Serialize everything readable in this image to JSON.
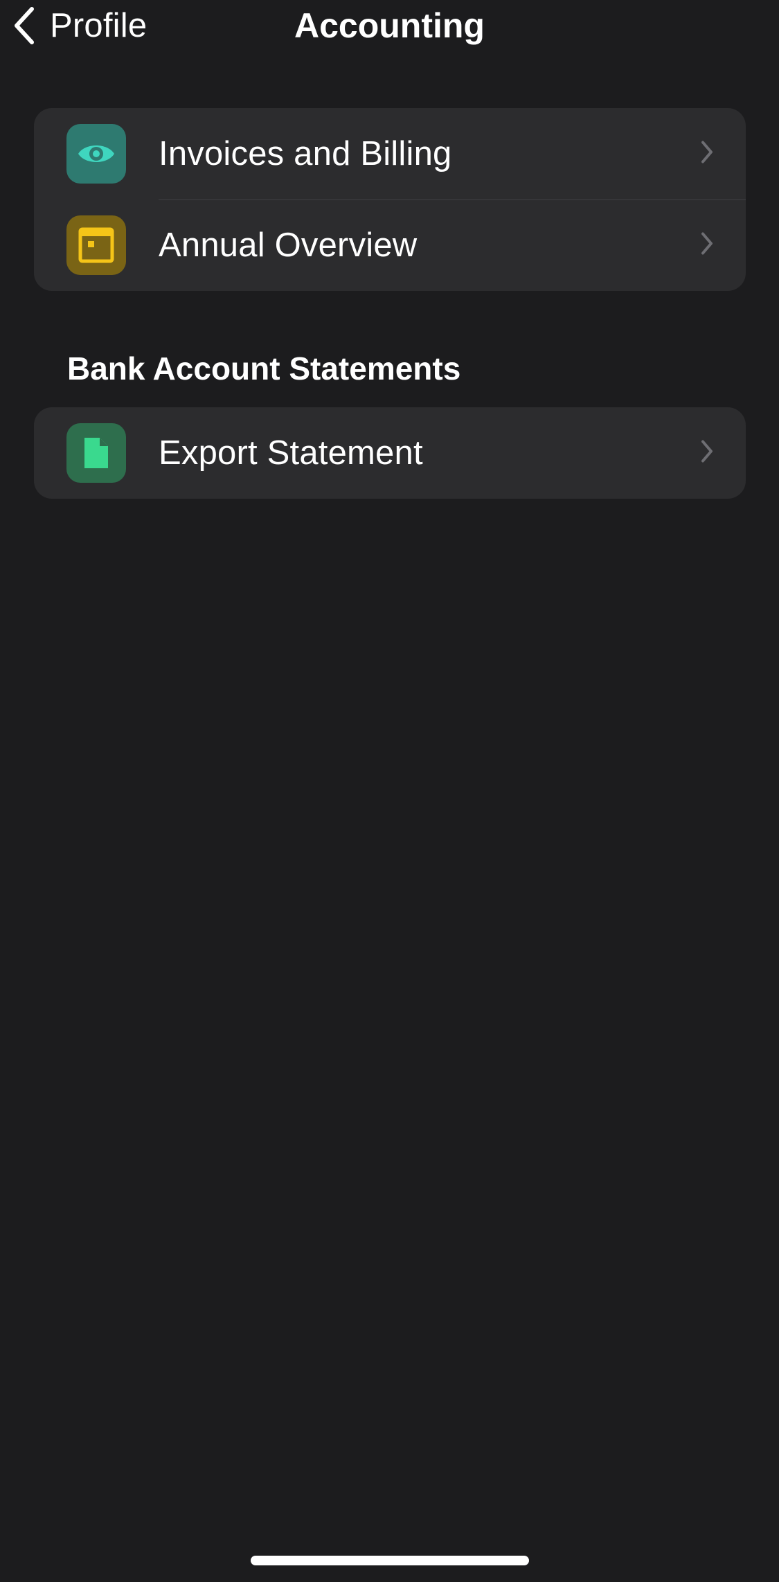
{
  "nav": {
    "back_label": "Profile",
    "title": "Accounting"
  },
  "group1": {
    "items": [
      {
        "label": "Invoices and Billing",
        "icon": "eye-icon",
        "tile_color": "#2e7a70",
        "glyph_color": "#3fd6bf"
      },
      {
        "label": "Annual Overview",
        "icon": "calendar-icon",
        "tile_color": "#7a6415",
        "glyph_color": "#f5c518"
      }
    ]
  },
  "section": {
    "header": "Bank Account Statements",
    "items": [
      {
        "label": "Export Statement",
        "icon": "document-icon",
        "tile_color": "#2e6e4d",
        "glyph_color": "#3ad98e"
      }
    ]
  },
  "colors": {
    "background": "#1c1c1e",
    "card": "#2c2c2e",
    "chevron": "#6e6e73"
  }
}
